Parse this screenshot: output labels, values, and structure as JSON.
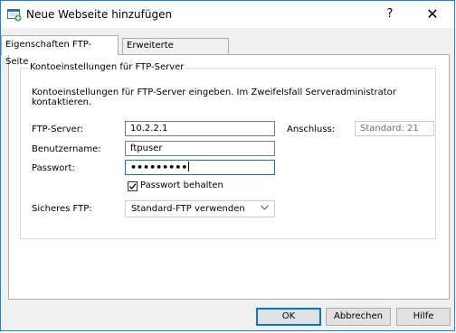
{
  "window": {
    "title": "Neue Webseite hinzufügen",
    "help_label": "?",
    "close_label": "✕"
  },
  "tabs": [
    {
      "label": "Eigenschaften FTP-Seite",
      "active": true
    },
    {
      "label": "Erweiterte Einstellungen",
      "active": false
    }
  ],
  "group": {
    "title": "Kontoeinstellungen für FTP-Server",
    "description": "Kontoeinstellungen für FTP-Server eingeben. Im Zweifelsfall Serveradministrator kontaktieren."
  },
  "form": {
    "server_label": "FTP-Server:",
    "server_value": "10.2.2.1",
    "port_label": "Anschluss:",
    "port_value": "Standard: 21",
    "username_label": "Benutzername:",
    "username_value": "ftpuser",
    "password_label": "Passwort:",
    "password_value": "•••••••••",
    "remember_label": "Passwort behalten",
    "remember_checked": true,
    "secure_label": "Sicheres FTP:",
    "secure_value": "Standard-FTP verwenden"
  },
  "buttons": {
    "ok": "OK",
    "cancel": "Abbrechen",
    "help": "Hilfe"
  },
  "colors": {
    "accent": "#0078d7",
    "window_border": "#1883d7"
  }
}
